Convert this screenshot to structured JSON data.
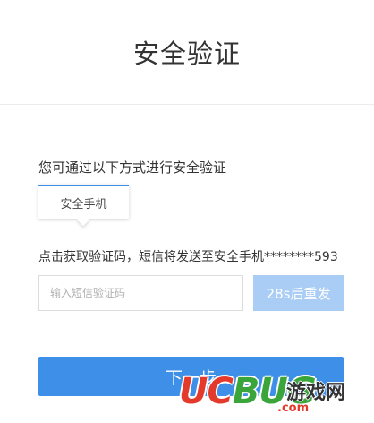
{
  "header": {
    "title": "安全验证"
  },
  "verify": {
    "prompt": "您可通过以下方式进行安全验证",
    "method_tab": "安全手机",
    "info_text": "点击获取验证码，短信将发送至安全手机********593",
    "code_placeholder": "输入短信验证码",
    "resend_label": "28s后重发",
    "next_label": "下一步"
  },
  "watermark": {
    "logo_uc": "UC",
    "logo_bug": "BUG",
    "logo_text": "游戏网",
    "logo_domain": ".com"
  },
  "colors": {
    "accent": "#3d8fe8",
    "disabled": "#a9cdf4"
  }
}
